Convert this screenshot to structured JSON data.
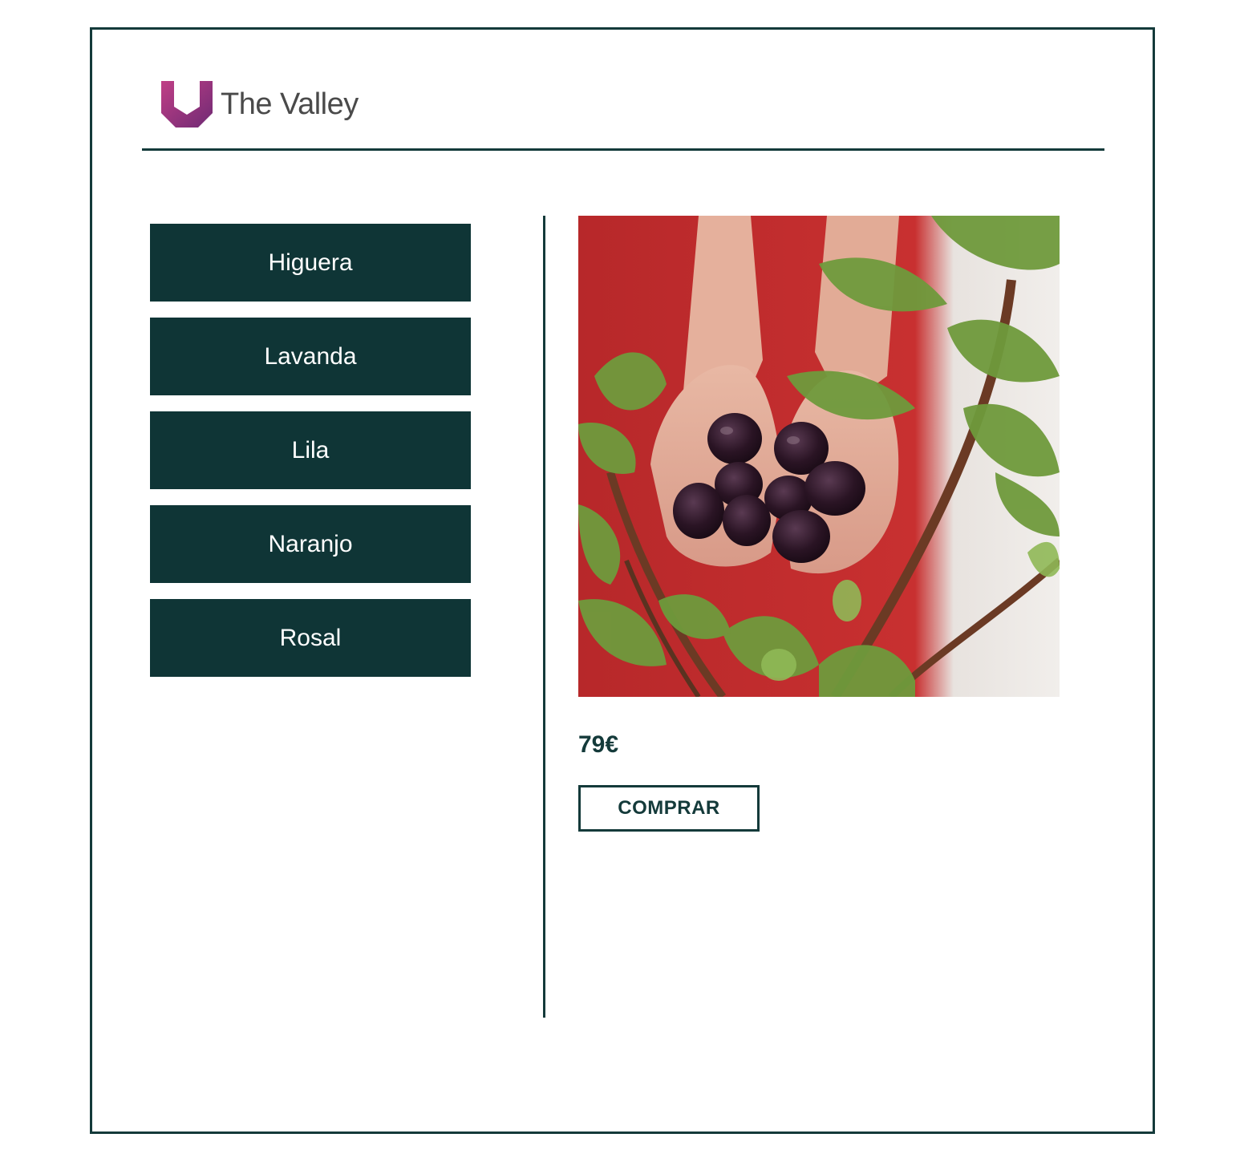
{
  "brand": {
    "name": "The Valley",
    "logo_icon": "valley-u-logo-icon",
    "logo_gradient": [
      "#b13a7c",
      "#7a2c77"
    ]
  },
  "colors": {
    "primary": "#0f3536",
    "border": "#143a3a",
    "logo_text": "#4a4a4a"
  },
  "plants": [
    {
      "label": "Higuera"
    },
    {
      "label": "Lavanda"
    },
    {
      "label": "Lila"
    },
    {
      "label": "Naranjo"
    },
    {
      "label": "Rosal"
    }
  ],
  "product": {
    "image": "fig-tree-photo",
    "price": "79€",
    "buy_label": "COMPRAR"
  }
}
